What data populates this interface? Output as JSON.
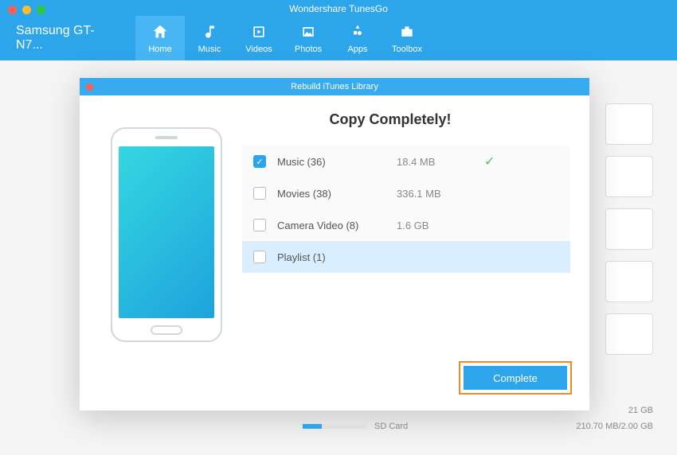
{
  "app_title": "Wondershare TunesGo",
  "device_name": "Samsung GT-N7...",
  "nav": [
    {
      "label": "Home",
      "icon": "home"
    },
    {
      "label": "Music",
      "icon": "music"
    },
    {
      "label": "Videos",
      "icon": "video"
    },
    {
      "label": "Photos",
      "icon": "photo"
    },
    {
      "label": "Apps",
      "icon": "apps"
    },
    {
      "label": "Toolbox",
      "icon": "toolbox"
    }
  ],
  "modal": {
    "title": "Rebuild iTunes Library",
    "heading": "Copy Completely!",
    "rows": [
      {
        "label": "Music (36)",
        "size": "18.4 MB",
        "checked": true,
        "done": true
      },
      {
        "label": "Movies (38)",
        "size": "336.1 MB",
        "checked": false,
        "done": false
      },
      {
        "label": "Camera Video (8)",
        "size": "1.6 GB",
        "checked": false,
        "done": false
      },
      {
        "label": "Playlist (1)",
        "size": "",
        "checked": false,
        "done": false
      }
    ],
    "button": "Complete"
  },
  "footer": {
    "sd_label": "SD Card",
    "sd_value": "210.70 MB/2.00 GB",
    "phone_value": "21 GB"
  }
}
